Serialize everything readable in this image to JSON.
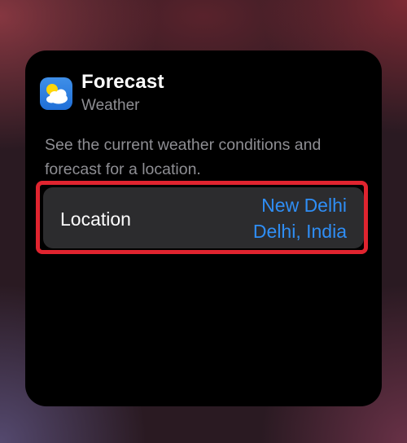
{
  "widget": {
    "title": "Forecast",
    "subtitle": "Weather",
    "description": "See the current weather conditions and forecast for a location.",
    "app_icon": "weather-cloud-sun-icon"
  },
  "location": {
    "label": "Location",
    "value_line1": "New Delhi",
    "value_line2": "Delhi, India"
  },
  "colors": {
    "accent": "#2f8ef5",
    "highlight": "#e0242f",
    "row_background": "#2c2c2e",
    "widget_background": "#000000"
  }
}
